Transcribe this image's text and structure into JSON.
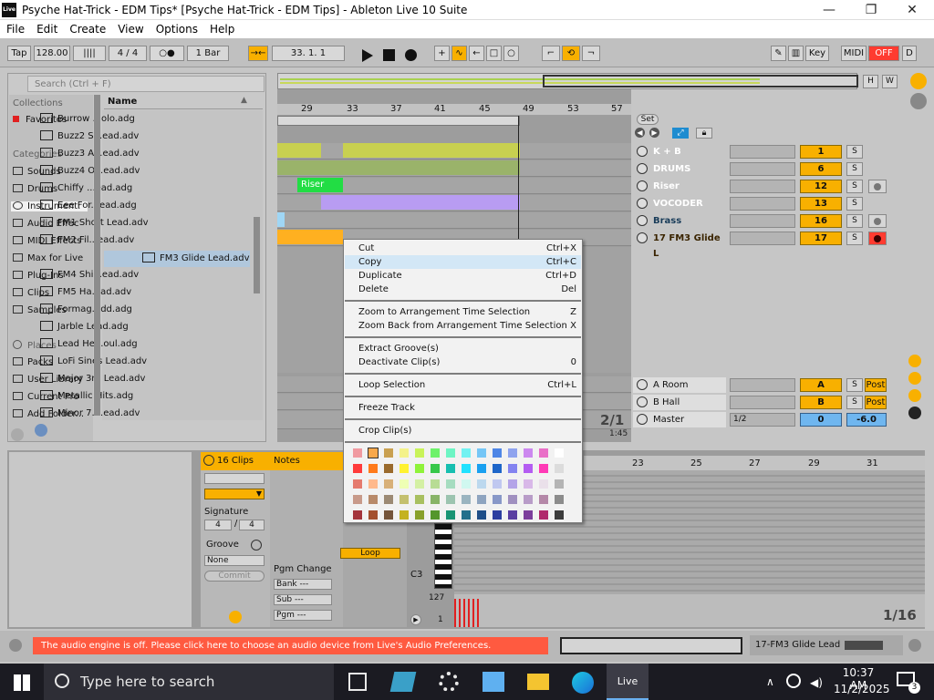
{
  "window": {
    "logo": "Live",
    "title": "Psyche Hat-Trick - EDM Tips*  [Psyche Hat-Trick - EDM Tips] - Ableton Live 10 Suite",
    "minimize": "—",
    "maximize": "❐",
    "close": "✕"
  },
  "menu": [
    "File",
    "Edit",
    "Create",
    "View",
    "Options",
    "Help"
  ],
  "control_bar": {
    "tap": "Tap",
    "tempo": "128.00",
    "nudge": "||||",
    "signature": "4  /  4",
    "metronome": "○●",
    "quantize": "1 Bar",
    "follow": "→←",
    "position": "33.   1.   1",
    "key": "Key",
    "midi": "MIDI",
    "cpu_off": "OFF",
    "d": "D",
    "colors": {
      "accent_orange": "#f8b000",
      "red": "#ff3b30"
    }
  },
  "browser": {
    "search_placeholder": "Search (Ctrl + F)",
    "collections_header": "Collections",
    "favorites": "Favorites",
    "categories_header": "Categories",
    "categories": [
      "Sounds",
      "Drums",
      "Instruments",
      "Audio Effects",
      "MIDI Effects",
      "Max for Live",
      "Plug-Ins",
      "Clips",
      "Samples"
    ],
    "categories_display": [
      "Sounds",
      "Drums",
      "Instrument:",
      "Audio Effec",
      "MIDI Effects",
      "Max for Live",
      "Plug-Ins",
      "Clips",
      "Samples"
    ],
    "places_header": "Places",
    "places": [
      "Packs",
      "User Library",
      "Current Pro",
      "Add Folder..."
    ],
    "name_header": "Name",
    "files": [
      "Burrow ...olo.adg",
      "Buzz2 S...ead.adv",
      "Buzz3 A...ead.adv",
      "Buzz4 O...ead.adv",
      "Chiffy ...ead.adg",
      "Eee For...ead.adg",
      "FM1 Short Lead.adv",
      "FM2 Fil...ead.adv",
      "FM3 Glide Lead.adv",
      "FM4 Shi...ead.adv",
      "FM5 Ha...ad.adv",
      "Formag...dd.adg",
      "Jarble Lead.adg",
      "Lead He...oul.adg",
      "LoFi Sines Lead.adv",
      "Major 3rd Lead.adv",
      "Metallic Hits.adg",
      "Minor 7....ead.adv"
    ],
    "selected_file": "FM3 Glide Lead.adv"
  },
  "arrangement": {
    "ruler": [
      "29",
      "33",
      "37",
      "41",
      "45",
      "49",
      "53",
      "57"
    ],
    "set_label": "Set",
    "overview_buttons": [
      "H",
      "W"
    ],
    "clip_riser": "Riser",
    "zoom_label": "2/1",
    "time_label": "1:45"
  },
  "tracks": [
    {
      "name": "K + B",
      "num": "1",
      "solo": "S",
      "color": "#ff3b3b"
    },
    {
      "name": "DRUMS",
      "num": "6",
      "solo": "S",
      "color": "#3aa33a"
    },
    {
      "name": "Riser",
      "num": "12",
      "solo": "S",
      "color": "#22dd44"
    },
    {
      "name": "VOCODER",
      "num": "13",
      "solo": "S",
      "color": "#ee3a8a"
    },
    {
      "name": "Brass",
      "num": "16",
      "solo": "S",
      "color": "#9fd6f5"
    },
    {
      "name": "17 FM3 Glide L",
      "num": "17",
      "solo": "S",
      "color": "#ffb020"
    }
  ],
  "returns": [
    {
      "name": "A Room",
      "num": "A",
      "solo": "S",
      "post": "Post"
    },
    {
      "name": "B Hall",
      "num": "B",
      "solo": "S",
      "post": "Post"
    }
  ],
  "master": {
    "name": "Master",
    "cue": "1/2",
    "num": "0",
    "volume": "-6.0"
  },
  "context_menu": {
    "groups": [
      [
        {
          "label": "Cut",
          "shortcut": "Ctrl+X"
        },
        {
          "label": "Copy",
          "shortcut": "Ctrl+C"
        },
        {
          "label": "Duplicate",
          "shortcut": "Ctrl+D"
        },
        {
          "label": "Delete",
          "shortcut": "Del"
        }
      ],
      [
        {
          "label": "Zoom to Arrangement Time Selection",
          "shortcut": "Z"
        },
        {
          "label": "Zoom Back from Arrangement Time Selection",
          "shortcut": "X"
        }
      ],
      [
        {
          "label": "Extract Groove(s)",
          "shortcut": ""
        },
        {
          "label": "Deactivate Clip(s)",
          "shortcut": "0"
        }
      ],
      [
        {
          "label": "Loop Selection",
          "shortcut": "Ctrl+L"
        }
      ],
      [
        {
          "label": "Freeze Track",
          "shortcut": ""
        }
      ],
      [
        {
          "label": "Crop Clip(s)",
          "shortcut": ""
        }
      ]
    ],
    "highlighted": "Copy",
    "palette": [
      [
        "#f09aa0",
        "#f8a84b",
        "#c9a050",
        "#f4f28a",
        "#c9f35a",
        "#6ef26a",
        "#6df5c4",
        "#72f2f2",
        "#75c6f6",
        "#4f86e6",
        "#8fa3ee",
        "#cc88ef",
        "#e96fc7",
        "#ffffff"
      ],
      [
        "#ff3b3b",
        "#ff7a1a",
        "#9a6a2c",
        "#fff232",
        "#8ff33a",
        "#37c84a",
        "#17bfb0",
        "#22e2ff",
        "#1aa0f0",
        "#1e66c9",
        "#8383f0",
        "#b45df2",
        "#ff3ab6",
        "#dcdcdc"
      ],
      [
        "#e57a6e",
        "#ffb98c",
        "#d8b078",
        "#eeffb4",
        "#d4f0a4",
        "#b8dc94",
        "#a6dcc0",
        "#d0f8f0",
        "#bcd8ee",
        "#c0c8f0",
        "#b4a4e8",
        "#d8b8e8",
        "#eae0ea",
        "#b4b4b4"
      ],
      [
        "#c89a8a",
        "#b88a6a",
        "#9c8a74",
        "#c4c06e",
        "#a8c060",
        "#88b468",
        "#9cc4b0",
        "#9ab4c0",
        "#8ea4c0",
        "#8898c8",
        "#a090c0",
        "#b89cc8",
        "#b488a8",
        "#8c8c8c"
      ],
      [
        "#a4343c",
        "#a4502e",
        "#74543a",
        "#c4b220",
        "#88a02a",
        "#54962c",
        "#189474",
        "#24708c",
        "#1e4e88",
        "#2c3ea0",
        "#5a3ea2",
        "#7c3e9c",
        "#b02a6c",
        "#3c3c3c"
      ]
    ],
    "selected_swatch": [
      0,
      1
    ]
  },
  "detail": {
    "clip_count": "16 Clips",
    "notes_tab": "Notes",
    "signature_label": "Signature",
    "sig_num": "4",
    "sig_den": "4",
    "groove_label": "Groove",
    "groove_value": "None",
    "commit": "Commit",
    "pgm_change": "Pgm Change",
    "bank": "Bank ---",
    "sub": "Sub ---",
    "pgm": "Pgm ---",
    "loop": "Loop",
    "c3": "C3",
    "vel_max": "127",
    "vel_min": "1",
    "ruler": [
      "23",
      "25",
      "27",
      "29",
      "31"
    ],
    "grid": "1/16"
  },
  "status_bar": {
    "message": "The audio engine is off. Please click here to choose an audio device from Live's Audio Preferences.",
    "track_name": "17-FM3 Glide Lead"
  },
  "taskbar": {
    "search_placeholder": "Type here to search",
    "live_app": "Live",
    "time": "10:37 AM",
    "date": "11/2/2025",
    "notifications": "3"
  }
}
